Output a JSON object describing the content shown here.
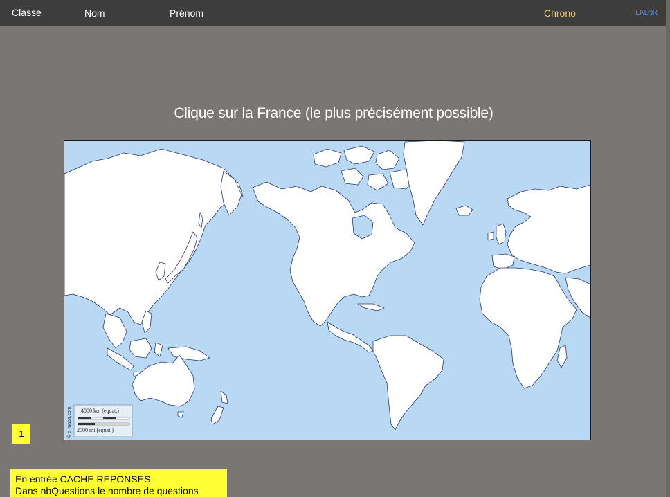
{
  "topbar": {
    "classe": "Classe",
    "nom": "Nom",
    "prenom": "Prénom",
    "chrono": "Chrono",
    "code": "EKLNR"
  },
  "question": "Clique sur la France (le plus précisément possible)",
  "map": {
    "credit": "© d-maps.com",
    "scale_km": "4000 km (equat.)",
    "scale_mi": "2000 mi (equat.)",
    "colors": {
      "ocean": "#b9d8f3",
      "land": "#ffffff",
      "coast": "#2a3a6a"
    }
  },
  "question_number": "1",
  "note": {
    "line1": "En entrée CACHE REPONSES",
    "line2": "Dans nbQuestions le nombre de questions"
  }
}
